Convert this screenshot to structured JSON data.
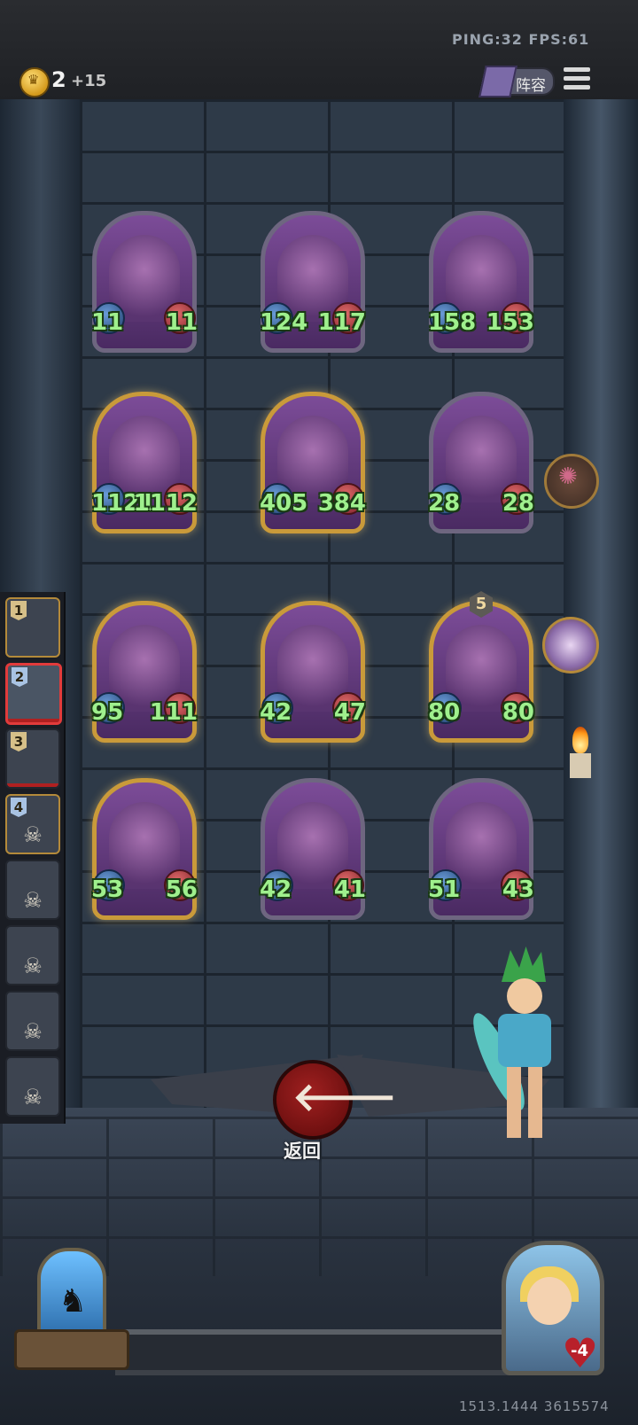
{
  "top_bar": {
    "ping_fps": "PING:32  FPS:61",
    "gold": "2",
    "income": "+15",
    "lineup_label": "阵容"
  },
  "board": {
    "rows": [
      [
        {
          "atk": "11",
          "hp": "11",
          "frame": "silver"
        },
        {
          "atk": "124",
          "hp": "117",
          "frame": "silver"
        },
        {
          "atk": "158",
          "hp": "153",
          "frame": "silver"
        }
      ],
      [
        {
          "atk": "1121",
          "hp": "1112",
          "frame": "gold"
        },
        {
          "atk": "405",
          "hp": "384",
          "frame": "gold"
        },
        {
          "atk": "28",
          "hp": "28",
          "frame": "silver"
        }
      ],
      [
        {
          "atk": "95",
          "hp": "111",
          "frame": "gold"
        },
        {
          "atk": "42",
          "hp": "47",
          "frame": "gold"
        },
        {
          "atk": "80",
          "hp": "80",
          "frame": "gold",
          "badge": "5"
        }
      ],
      [
        {
          "atk": "53",
          "hp": "56",
          "frame": "gold"
        },
        {
          "atk": "42",
          "hp": "41",
          "frame": "silver"
        },
        {
          "atk": "51",
          "hp": "43",
          "frame": "silver"
        }
      ]
    ]
  },
  "queue": {
    "items": [
      {
        "num": "1"
      },
      {
        "num": "2"
      },
      {
        "num": "3"
      },
      {
        "num": "4"
      }
    ]
  },
  "back": {
    "label": "返回"
  },
  "opponent": {
    "hp": "-4"
  },
  "footer": {
    "coords": "1513.1444 3615574"
  },
  "colors": {
    "stat_green": "#9ff08d",
    "accent_red": "#a02020",
    "gold_frame": "#c99a3a"
  }
}
